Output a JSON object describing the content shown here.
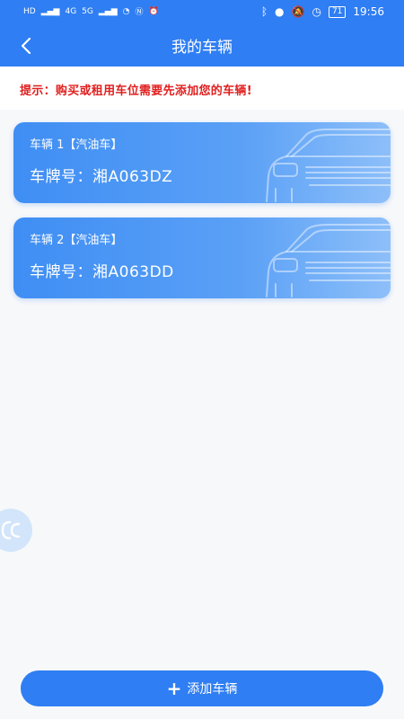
{
  "status_bar": {
    "left_labels": [
      "HD",
      "4G",
      "5G"
    ],
    "battery": "71",
    "time": "19:56"
  },
  "header": {
    "title": "我的车辆"
  },
  "notice": {
    "text": "提示：购买或租用车位需要先添加您的车辆!"
  },
  "vehicles": [
    {
      "title": "车辆 1【汽油车】",
      "plate": "车牌号：湘A063DZ"
    },
    {
      "title": "车辆 2【汽油车】",
      "plate": "车牌号：湘A063DD"
    }
  ],
  "footer": {
    "add_label": "添加车辆"
  },
  "colors": {
    "primary": "#2f7ef3",
    "notice_text": "#e02020",
    "background": "#f7f8fa"
  }
}
